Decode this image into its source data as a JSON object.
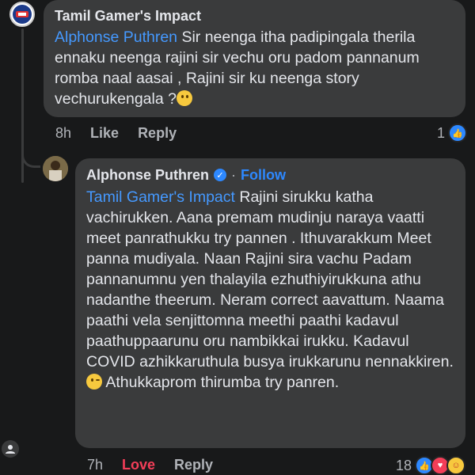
{
  "comment": {
    "author": "Tamil Gamer's Impact",
    "mention": "Alphonse Puthren",
    "text": " Sir neenga itha padipingala therila ennaku neenga rajini sir vechu oru padom pannanum romba naal aasai , Rajini sir ku neenga story vechurukengala ?",
    "time": "8h",
    "like_label": "Like",
    "reply_label": "Reply",
    "reaction_count": "1"
  },
  "reply": {
    "author": "Alphonse Puthren",
    "separator": "·",
    "follow_label": "Follow",
    "mention": "Tamil Gamer's Impact",
    "text": " Rajini sirukku katha vachirukken. Aana premam mudinju naraya vaatti meet panrathukku try pannen . Ithuvarakkum Meet panna mudiyala. Naan Rajini sira vachu Padam pannanumnu yen thalayila ezhuthiyirukkuna athu nadanthe theerum. Neram correct aavattum. Naama paathi vela senjittomna meethi paathi kadavul paathuppaarunu oru nambikkai irukku. Kadavul COVID azhikkaruthula busya irukkarunu nennakkiren. ",
    "text_end": " Athukkaprom thirumba try panren.",
    "time": "7h",
    "love_label": "Love",
    "reply_label": "Reply",
    "reaction_count": "18"
  },
  "colors": {
    "background": "#18191a",
    "bubble": "#3a3b3c",
    "mention": "#4599ff",
    "love": "#f33e58",
    "accent": "#2d88ff"
  },
  "icons": {
    "reaction_like": "like-icon",
    "reaction_love": "love-icon",
    "reaction_care": "care-icon",
    "emoji_smile": "smile-emoji",
    "emoji_wink": "wink-emoji"
  }
}
